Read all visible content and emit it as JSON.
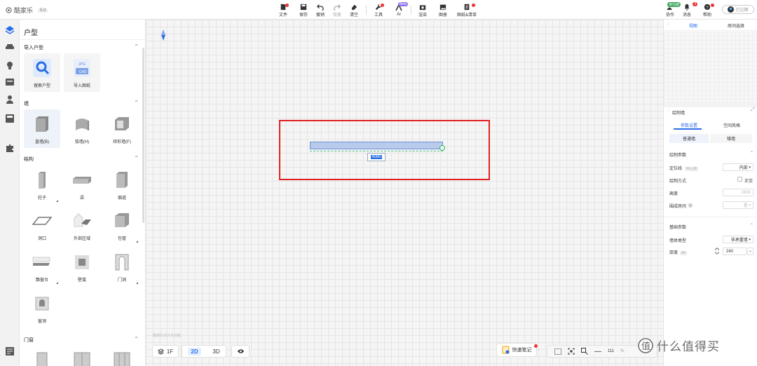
{
  "app": {
    "logo": "酷家乐",
    "version": "5.0"
  },
  "toolbar": {
    "file": "文件",
    "save": "保存",
    "undo": "撤销",
    "redo": "恢复",
    "clear": "清空",
    "tools": "工具",
    "ai": "AI",
    "ai_badge": "Beta",
    "render": "渲染",
    "gallery": "图册",
    "drawings": "图纸&清单"
  },
  "user": {
    "collab": "协作",
    "collab_badge": "新功能",
    "messages": "消息",
    "messages_badge": "3",
    "help": "帮助",
    "vip": "已过期"
  },
  "left": {
    "title": "户型",
    "sections": {
      "import": "导入户型",
      "wall": "墙",
      "structure": "结构",
      "door_window": "门窗"
    },
    "import_items": [
      "搜索户型",
      "导入图纸"
    ],
    "wall_items": [
      "直墙(B)",
      "弧墙(H)",
      "矩形墙(F)"
    ],
    "structure_items": [
      "柱子",
      "梁",
      "烟道",
      "洞口",
      "外部区域",
      "包管",
      "飘窗台",
      "壁龛",
      "门洞",
      "窗洞"
    ],
    "jpg": "JPG",
    "cad": "CAD"
  },
  "canvas": {
    "dimension": "4080",
    "floor": "1F",
    "mode_2d": "2D",
    "mode_3d": "3D",
    "hint": "酷家乐设计全功能",
    "note": "快速笔记",
    "zoom": "111",
    "unit": "%"
  },
  "right": {
    "tabs": [
      "视图",
      "房间选择"
    ],
    "panel_title": "绘制墙",
    "sub_tabs": [
      "参数设置",
      "空间风格"
    ],
    "wall_types": [
      "普通墙",
      "矮墙"
    ],
    "draw_params": "绘制参数",
    "locate_label": "定位线",
    "locate_hint": "中心线",
    "locate_value": "内部",
    "method_label": "绘制方式",
    "method_value": "正交",
    "height_label": "高度",
    "height_value": "2800",
    "room_label": "围成房间",
    "room_value": "是",
    "base_params": "基础参数",
    "wall_type_label": "墙体类型",
    "wall_type_value": "非承重墙",
    "thickness_label": "厚度",
    "thickness_key": "Alt",
    "thickness_value": "240"
  },
  "watermark": "值 什么值得买",
  "colors": {
    "accent": "#2a6ee8",
    "selection_red": "#e02020",
    "wall_fill": "#b9cbea"
  }
}
